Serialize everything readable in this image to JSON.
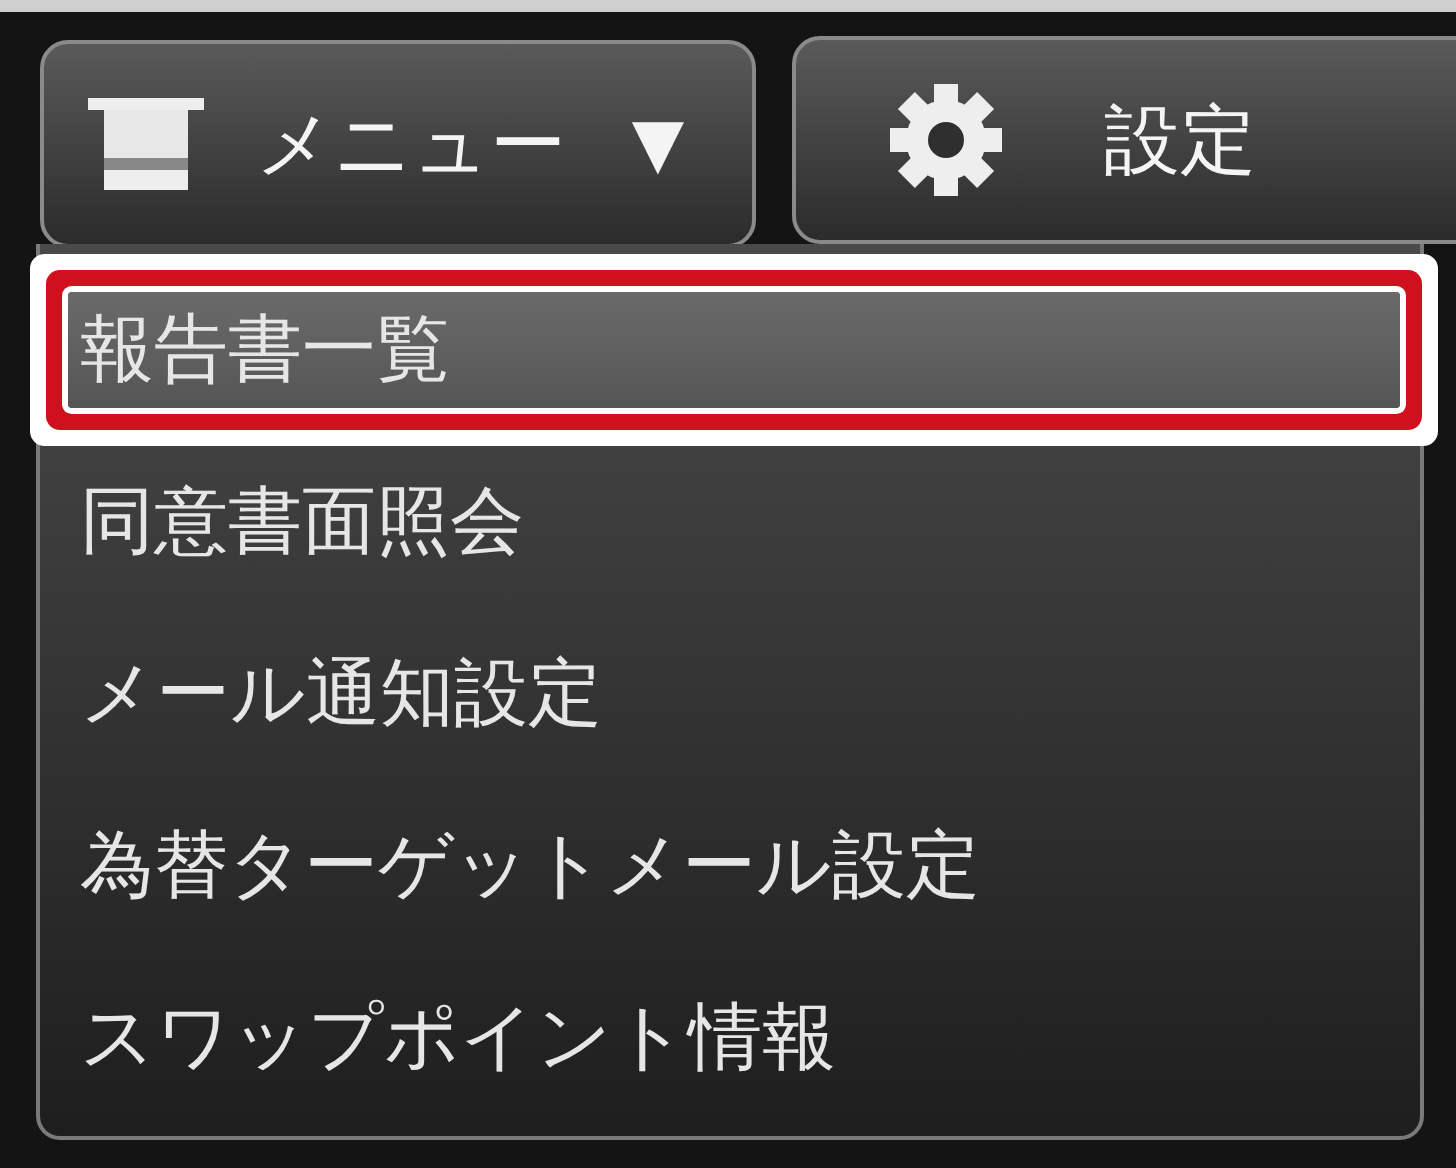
{
  "toolbar": {
    "menu_button": {
      "label": "メニュー",
      "caret": "▼"
    },
    "settings_button": {
      "label": "設定"
    }
  },
  "dropdown": {
    "items": [
      {
        "label": "報告書一覧",
        "selected": true
      },
      {
        "label": "同意書面照会",
        "selected": false
      },
      {
        "label": "メール通知設定",
        "selected": false
      },
      {
        "label": "為替ターゲットメール設定",
        "selected": false
      },
      {
        "label": "スワップポイント情報",
        "selected": false
      }
    ]
  }
}
